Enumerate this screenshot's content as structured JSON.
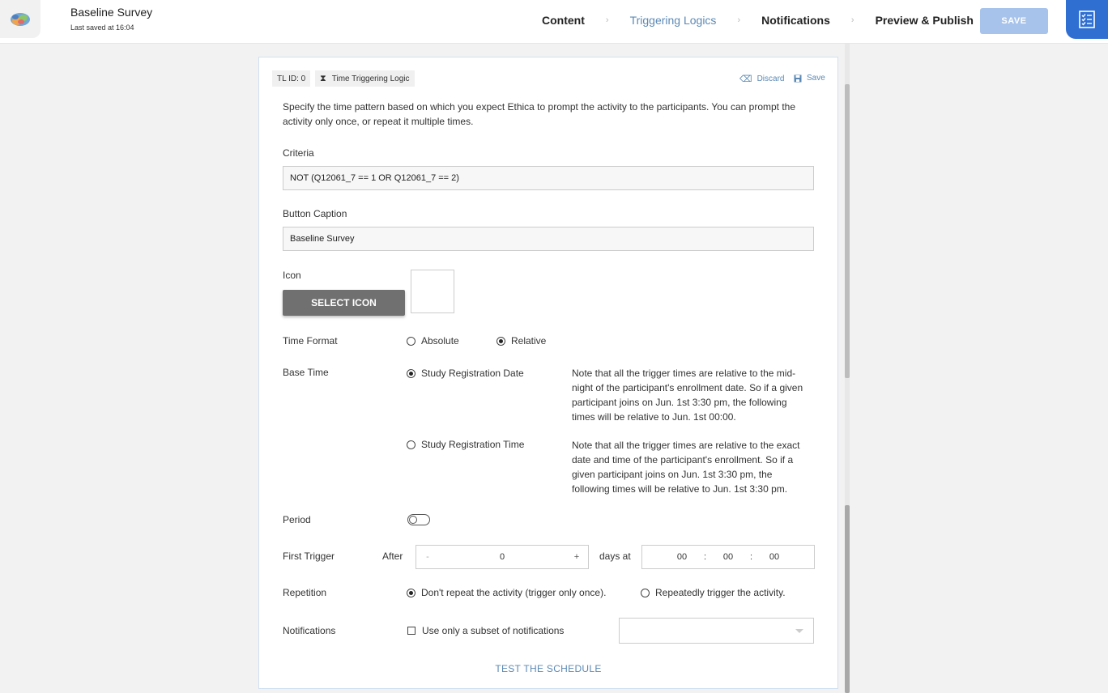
{
  "header": {
    "title": "Baseline Survey",
    "last_saved": "Last saved at 16:04",
    "tabs": [
      {
        "label": "Content"
      },
      {
        "label": "Triggering Logics"
      },
      {
        "label": "Notifications"
      },
      {
        "label": "Preview & Publish"
      }
    ],
    "separator": "›",
    "save_label": "SAVE",
    "active_tab_color": "#5b89b4",
    "save_button_color": "#a7c3eb",
    "panel_button_color": "#2f6fd2"
  },
  "card": {
    "tl_id": "TL ID: 0",
    "type_label": "Time Triggering Logic",
    "type_icon": "hourglass-icon",
    "discard_label": "Discard",
    "save_label": "Save",
    "description": "Specify the time pattern based on which you expect Ethica to prompt the activity to the participants. You can prompt the activity only once, or repeat it multiple times.",
    "criteria": {
      "label": "Criteria",
      "value": "NOT (Q12061_7 == 1 OR Q12061_7 == 2)"
    },
    "button_caption": {
      "label": "Button Caption",
      "value": "Baseline Survey"
    },
    "icon": {
      "label": "Icon",
      "select_label": "SELECT ICON"
    },
    "time_format": {
      "label": "Time Format",
      "options": [
        {
          "label": "Absolute",
          "selected": false
        },
        {
          "label": "Relative",
          "selected": true
        }
      ]
    },
    "base_time": {
      "label": "Base Time",
      "options": [
        {
          "label": "Study Registration Date",
          "selected": true,
          "note": "Note that all the trigger times are relative to the mid-night of the participant's enrollment date. So if a given participant joins on Jun. 1st 3:30 pm, the following times will be relative to Jun. 1st 00:00."
        },
        {
          "label": "Study Registration Time",
          "selected": false,
          "note": "Note that all the trigger times are relative to the exact date and time of the participant's enrollment. So if a given participant joins on Jun. 1st 3:30 pm, the following times will be relative to Jun. 1st 3:30 pm."
        }
      ]
    },
    "period": {
      "label": "Period",
      "enabled": false
    },
    "first_trigger": {
      "label": "First Trigger",
      "after_label": "After",
      "minus": "-",
      "plus": "+",
      "days": "0",
      "days_at_label": "days at",
      "hours": "00",
      "minutes": "00",
      "seconds": "00",
      "colon": ":"
    },
    "repetition": {
      "label": "Repetition",
      "options": [
        {
          "label": "Don't repeat the activity (trigger only once).",
          "selected": true
        },
        {
          "label": "Repeatedly trigger the activity.",
          "selected": false
        }
      ]
    },
    "notifications": {
      "label": "Notifications",
      "checkbox_label": "Use only a subset of notifications",
      "checked": false,
      "dropdown_value": ""
    },
    "test_label": "TEST THE SCHEDULE"
  }
}
